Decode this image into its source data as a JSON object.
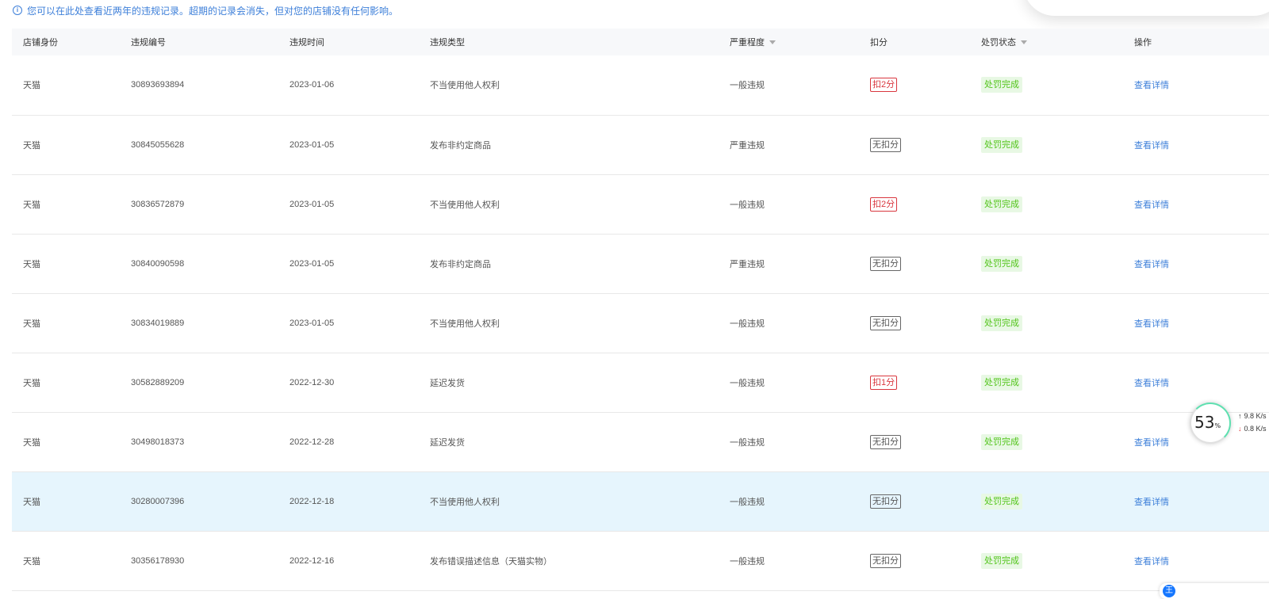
{
  "notice": {
    "text": "您可以在此处查看近两年的违规记录。超期的记录会消失，但对您的店铺没有任何影响。"
  },
  "table": {
    "headers": {
      "store_identity": "店铺身份",
      "violation_id": "违规编号",
      "violation_time": "违规时间",
      "violation_type": "违规类型",
      "severity": "严重程度",
      "deduction": "扣分",
      "penalty_status": "处罚状态",
      "action": "操作"
    },
    "rows": [
      {
        "store": "天猫",
        "id": "30893693894",
        "date": "2023-01-06",
        "type": "不当使用他人权利",
        "severity": "一般违规",
        "deduction": "扣2分",
        "deducted": true,
        "status": "处罚完成",
        "action": "查看详情"
      },
      {
        "store": "天猫",
        "id": "30845055628",
        "date": "2023-01-05",
        "type": "发布非约定商品",
        "severity": "严重违规",
        "deduction": "无扣分",
        "deducted": false,
        "status": "处罚完成",
        "action": "查看详情"
      },
      {
        "store": "天猫",
        "id": "30836572879",
        "date": "2023-01-05",
        "type": "不当使用他人权利",
        "severity": "一般违规",
        "deduction": "扣2分",
        "deducted": true,
        "status": "处罚完成",
        "action": "查看详情"
      },
      {
        "store": "天猫",
        "id": "30840090598",
        "date": "2023-01-05",
        "type": "发布非约定商品",
        "severity": "严重违规",
        "deduction": "无扣分",
        "deducted": false,
        "status": "处罚完成",
        "action": "查看详情"
      },
      {
        "store": "天猫",
        "id": "30834019889",
        "date": "2023-01-05",
        "type": "不当使用他人权利",
        "severity": "一般违规",
        "deduction": "无扣分",
        "deducted": false,
        "status": "处罚完成",
        "action": "查看详情"
      },
      {
        "store": "天猫",
        "id": "30582889209",
        "date": "2022-12-30",
        "type": "延迟发货",
        "severity": "一般违规",
        "deduction": "扣1分",
        "deducted": true,
        "status": "处罚完成",
        "action": "查看详情"
      },
      {
        "store": "天猫",
        "id": "30498018373",
        "date": "2022-12-28",
        "type": "延迟发货",
        "severity": "一般违规",
        "deduction": "无扣分",
        "deducted": false,
        "status": "处罚完成",
        "action": "查看详情"
      },
      {
        "store": "天猫",
        "id": "30280007396",
        "date": "2022-12-18",
        "type": "不当使用他人权利",
        "severity": "一般违规",
        "deduction": "无扣分",
        "deducted": false,
        "status": "处罚完成",
        "action": "查看详情",
        "highlighted": true
      },
      {
        "store": "天猫",
        "id": "30356178930",
        "date": "2022-12-16",
        "type": "发布错误描述信息（天猫实物）",
        "severity": "一般违规",
        "deduction": "无扣分",
        "deducted": false,
        "status": "处罚完成",
        "action": "查看详情"
      }
    ]
  },
  "network_monitor": {
    "percent": "53",
    "percent_unit": "%",
    "upload": "9.8 K/s",
    "download": "0.8 K/s"
  },
  "bottom_widget": {
    "logo": "王"
  },
  "colors": {
    "link": "#3d7fd9",
    "deduct": "#d9363e",
    "status_bg": "#e8f8e4",
    "status_text": "#52c41a",
    "highlight_row": "#e6f5fd"
  }
}
